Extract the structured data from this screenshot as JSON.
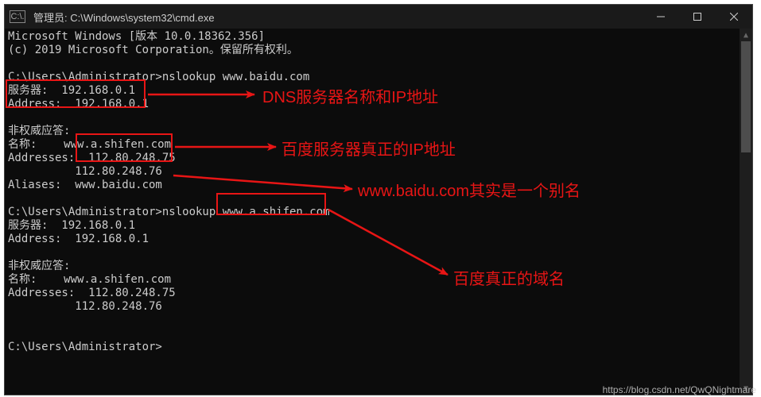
{
  "titlebar": {
    "icon_text": "C:\\.",
    "title": "管理员: C:\\Windows\\system32\\cmd.exe"
  },
  "terminal": {
    "l1": "Microsoft Windows [版本 10.0.18362.356]",
    "l2": "(c) 2019 Microsoft Corporation。保留所有权利。",
    "l3": "",
    "l4": "C:\\Users\\Administrator>nslookup www.baidu.com",
    "l5": "服务器:  192.168.0.1",
    "l6": "Address:  192.168.0.1",
    "l7": "",
    "l8": "非权威应答:",
    "l9": "名称:    www.a.shifen.com",
    "l10": "Addresses:  112.80.248.75",
    "l11": "          112.80.248.76",
    "l12": "Aliases:  www.baidu.com",
    "l13": "",
    "l14": "C:\\Users\\Administrator>nslookup www.a.shifen.com",
    "l15": "服务器:  192.168.0.1",
    "l16": "Address:  192.168.0.1",
    "l17": "",
    "l18": "非权威应答:",
    "l19": "名称:    www.a.shifen.com",
    "l20": "Addresses:  112.80.248.75",
    "l21": "          112.80.248.76",
    "l22": "",
    "l23": "",
    "l24": "C:\\Users\\Administrator>"
  },
  "annotations": {
    "a1": "DNS服务器名称和IP地址",
    "a2": "百度服务器真正的IP地址",
    "a3": "www.baidu.com其实是一个别名",
    "a4": "百度真正的域名"
  },
  "watermark": "https://blog.csdn.net/QwQNightmare",
  "colors": {
    "red": "#e81515",
    "terminal_bg": "#0c0c0c",
    "terminal_fg": "#cccccc"
  }
}
